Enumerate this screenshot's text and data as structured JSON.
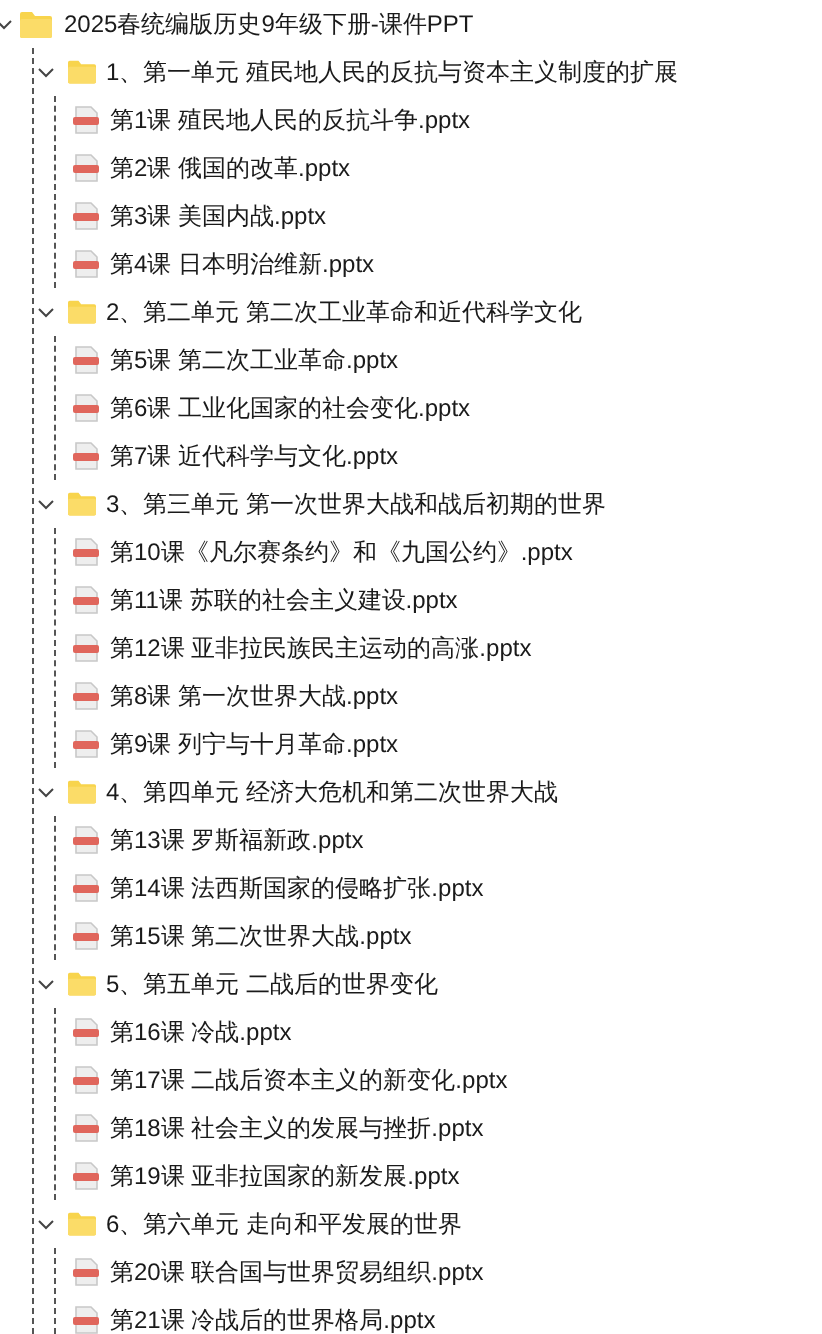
{
  "tree": {
    "label": "2025春统编版历史9年级下册-课件PPT",
    "expanded": true,
    "children": [
      {
        "label": "1、第一单元 殖民地人民的反抗与资本主义制度的扩展",
        "expanded": true,
        "children": [
          {
            "label": "第1课 殖民地人民的反抗斗争.pptx"
          },
          {
            "label": "第2课 俄国的改革.pptx"
          },
          {
            "label": "第3课 美国内战.pptx"
          },
          {
            "label": "第4课 日本明治维新.pptx"
          }
        ]
      },
      {
        "label": "2、第二单元 第二次工业革命和近代科学文化",
        "expanded": true,
        "children": [
          {
            "label": "第5课 第二次工业革命.pptx"
          },
          {
            "label": "第6课 工业化国家的社会变化.pptx"
          },
          {
            "label": "第7课 近代科学与文化.pptx"
          }
        ]
      },
      {
        "label": "3、第三单元 第一次世界大战和战后初期的世界",
        "expanded": true,
        "children": [
          {
            "label": "第10课《凡尔赛条约》和《九国公约》.pptx"
          },
          {
            "label": "第11课 苏联的社会主义建设.pptx"
          },
          {
            "label": "第12课 亚非拉民族民主运动的高涨.pptx"
          },
          {
            "label": "第8课 第一次世界大战.pptx"
          },
          {
            "label": "第9课 列宁与十月革命.pptx"
          }
        ]
      },
      {
        "label": "4、第四单元 经济大危机和第二次世界大战",
        "expanded": true,
        "children": [
          {
            "label": "第13课 罗斯福新政.pptx"
          },
          {
            "label": "第14课 法西斯国家的侵略扩张.pptx"
          },
          {
            "label": "第15课 第二次世界大战.pptx"
          }
        ]
      },
      {
        "label": "5、第五单元 二战后的世界变化",
        "expanded": true,
        "children": [
          {
            "label": "第16课 冷战.pptx"
          },
          {
            "label": "第17课 二战后资本主义的新变化.pptx"
          },
          {
            "label": "第18课 社会主义的发展与挫折.pptx"
          },
          {
            "label": "第19课 亚非拉国家的新发展.pptx"
          }
        ]
      },
      {
        "label": "6、第六单元 走向和平发展的世界",
        "expanded": true,
        "children": [
          {
            "label": "第20课 联合国与世界贸易组织.pptx"
          },
          {
            "label": "第21课 冷战后的世界格局.pptx"
          }
        ]
      }
    ]
  }
}
